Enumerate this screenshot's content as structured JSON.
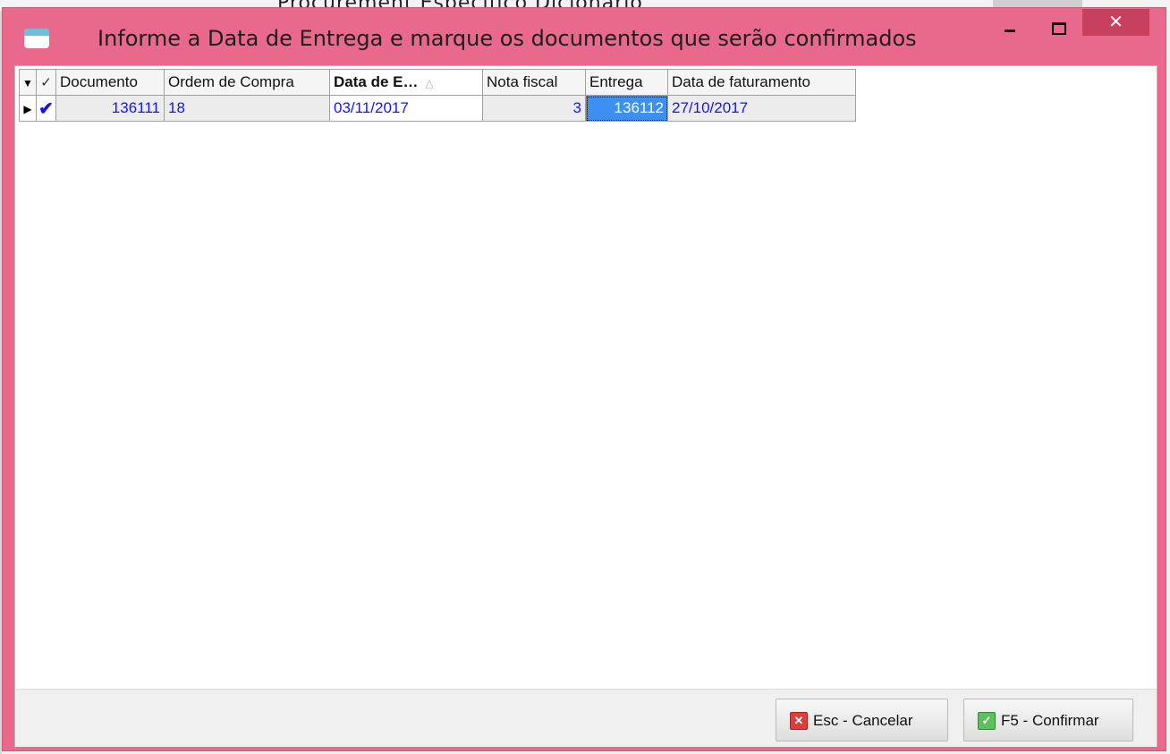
{
  "window": {
    "title": "Informe a Data de Entrega e marque os documentos que serão confirmados",
    "close_glyph": "✕",
    "accent_color": "#e8698c",
    "close_color": "#c7415f"
  },
  "background_text": "Procurement Específico Dicionário",
  "grid": {
    "columns": {
      "filter": "▼",
      "check": "✓",
      "documento": "Documento",
      "ordem_compra": "Ordem de Compra",
      "data_entrega": "Data de E…",
      "sort_indicator": "△",
      "nota_fiscal": "Nota fiscal",
      "entrega": "Entrega",
      "data_faturamento": "Data de faturamento"
    },
    "rows": [
      {
        "indicator": "▶",
        "checked": "✔",
        "documento": "136111",
        "ordem_compra": "18",
        "data_entrega": "03/11/2017",
        "nota_fiscal": "3",
        "entrega": "136112",
        "data_faturamento": "27/10/2017"
      }
    ]
  },
  "buttons": {
    "cancel": {
      "label": "Esc - Cancelar",
      "icon": "x-icon",
      "glyph": "✕"
    },
    "confirm": {
      "label": "F5 - Confirmar",
      "icon": "check-icon",
      "glyph": "✓"
    }
  }
}
